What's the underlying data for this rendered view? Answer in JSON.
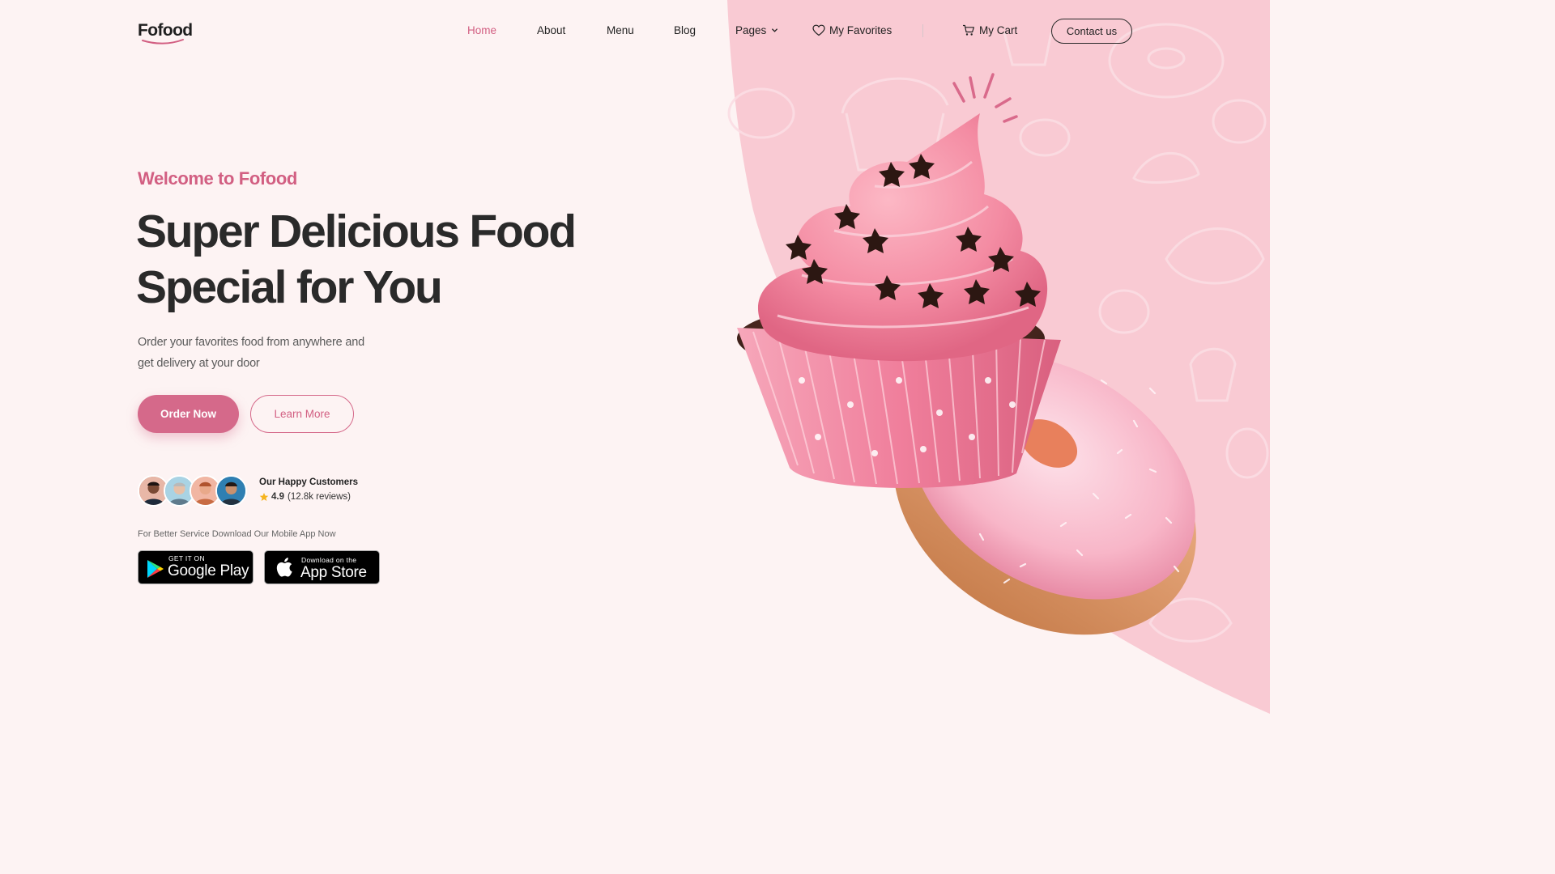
{
  "brand": {
    "logo_text": "Fofood",
    "accent": "#d25f82",
    "hero_panel_color": "#f9c9d2",
    "background": "#fdf3f3"
  },
  "nav": {
    "items": [
      {
        "label": "Home",
        "active": true
      },
      {
        "label": "About"
      },
      {
        "label": "Menu"
      },
      {
        "label": "Blog"
      },
      {
        "label": "Pages",
        "icon": "chevron-down-icon"
      }
    ],
    "favorites": {
      "label": "My Favorites",
      "icon": "heart-icon"
    },
    "cart": {
      "label": "My Cart",
      "icon": "cart-icon"
    },
    "contact_label": "Contact us"
  },
  "hero": {
    "welcome": "Welcome to Fofood",
    "headline_line1": "Super Delicious Food",
    "headline_line2": "Special for You",
    "description_line1": "Order your favorites food from anywhere and",
    "description_line2": "get delivery at your door",
    "order_button": "Order Now",
    "learn_button": "Learn More",
    "image": "pink-cupcake-and-donut-image"
  },
  "customers": {
    "title": "Our Happy Customers",
    "rating": "4.9",
    "reviews": "(12.8k reviews)",
    "star_icon": "star-icon",
    "avatar_count": 4
  },
  "app": {
    "cta": "For Better Service Download Our Mobile App Now",
    "google_play": {
      "small": "GET IT ON",
      "big": "Google Play",
      "icon": "play-store-icon"
    },
    "app_store": {
      "small": "Download on the",
      "big": "App Store",
      "icon": "apple-icon"
    }
  }
}
